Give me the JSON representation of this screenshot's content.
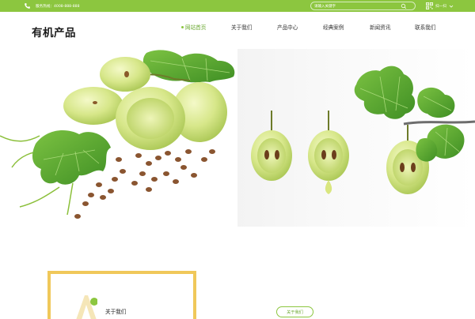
{
  "topbar": {
    "hotline": "服务热线：4008-888-888",
    "search_placeholder": "请输入关键字",
    "scan_label": "扫一扫"
  },
  "header": {
    "logo": "有机产品",
    "nav": [
      {
        "label": "网站首页",
        "active": true
      },
      {
        "label": "关于我们",
        "active": false
      },
      {
        "label": "产品中心",
        "active": false
      },
      {
        "label": "经典案例",
        "active": false
      },
      {
        "label": "新闻资讯",
        "active": false
      },
      {
        "label": "联系我们",
        "active": false
      }
    ]
  },
  "about": {
    "title": "关于我们",
    "button_label": "关于我们"
  },
  "colors": {
    "brand_green": "#8cc63f",
    "accent_yellow": "#f0c85a"
  }
}
